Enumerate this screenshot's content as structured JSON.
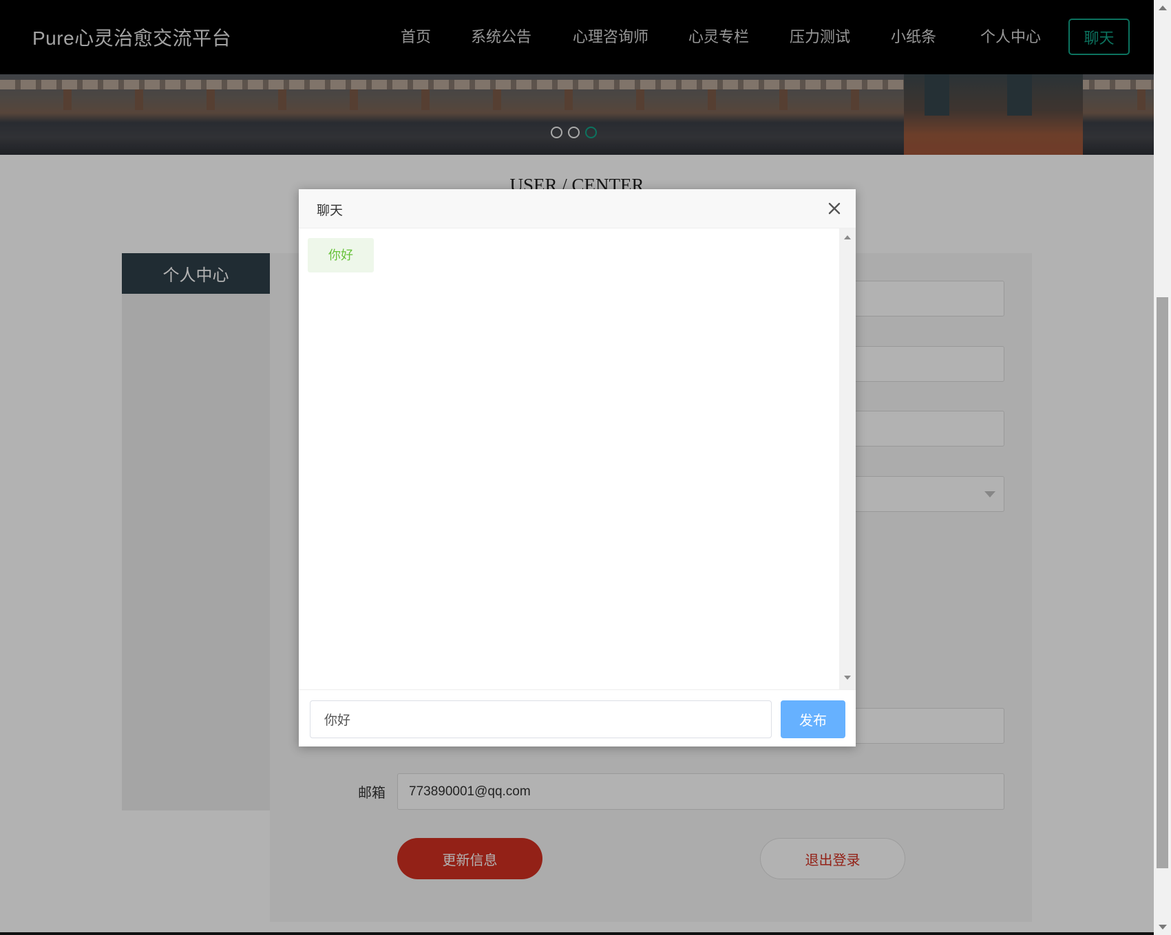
{
  "header": {
    "brand": "Pure心灵治愈交流平台",
    "nav": [
      {
        "label": "首页"
      },
      {
        "label": "系统公告"
      },
      {
        "label": "心理咨询师"
      },
      {
        "label": "心灵专栏"
      },
      {
        "label": "压力测试"
      },
      {
        "label": "小纸条"
      },
      {
        "label": "个人中心"
      }
    ],
    "chat_button": "聊天"
  },
  "carousel": {
    "slide_count": 3,
    "active_index": 2
  },
  "page": {
    "section_title": "USER / CENTER",
    "sidebar_title": "个人中心",
    "email_label": "邮箱",
    "email_value": "773890001@qq.com",
    "update_button": "更新信息",
    "logout_button": "退出登录"
  },
  "chat_dialog": {
    "title": "聊天",
    "messages": [
      {
        "text": "你好"
      }
    ],
    "input_value": "你好",
    "send_button": "发布"
  },
  "colors": {
    "accent": "#12a589",
    "danger": "#d33021",
    "send": "#66b1ff",
    "message_text": "#67c23a"
  },
  "icons": {
    "close": "close-icon"
  }
}
